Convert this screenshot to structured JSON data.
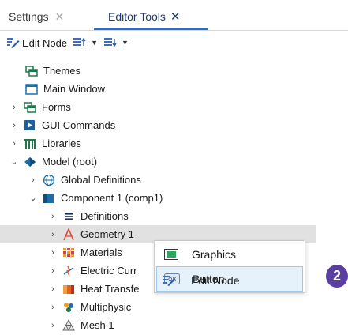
{
  "tabs": [
    {
      "label": "Settings",
      "close": "✕"
    },
    {
      "label": "Editor Tools",
      "close": "✕"
    }
  ],
  "toolbar": {
    "edit_node_label": "Edit Node",
    "sort_up_caret": "▼",
    "sort_down_caret": "▼"
  },
  "tree": {
    "themes": "Themes",
    "main_window": "Main Window",
    "forms": "Forms",
    "gui_commands": "GUI Commands",
    "libraries": "Libraries",
    "model_root": "Model (root)",
    "global_definitions": "Global Definitions",
    "component1": "Component 1 (comp1)",
    "definitions": "Definitions",
    "geometry1": "Geometry 1",
    "materials": "Materials",
    "electric_currents": "Electric Curr",
    "heat_transfer": "Heat Transfe",
    "multiphysics": "Multiphysic",
    "mesh1": "Mesh 1"
  },
  "context_menu": {
    "graphics": "Graphics",
    "button": "Button",
    "edit_node": "Edit Node"
  },
  "badge": "2",
  "colors": {
    "accent": "#1f6fd1",
    "badge": "#5b3fa0",
    "menu_hover": "#e5f1fb"
  }
}
